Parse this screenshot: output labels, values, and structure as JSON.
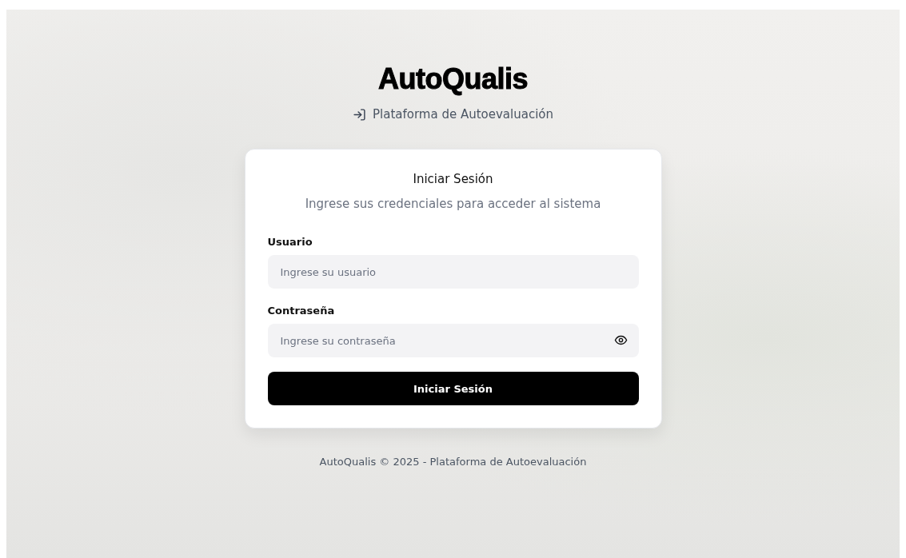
{
  "brand": {
    "title": "AutoQualis",
    "subtitle": "Plataforma de Autoevaluación"
  },
  "card": {
    "title": "Iniciar Sesión",
    "description": "Ingrese sus credenciales para acceder al sistema",
    "fields": [
      {
        "kind": "text",
        "label": "Usuario",
        "placeholder": "Ingrese su usuario"
      },
      {
        "kind": "password",
        "label": "Contraseña",
        "placeholder": "Ingrese su contraseña"
      }
    ],
    "submit": "Iniciar Sesión"
  },
  "footer": "AutoQualis © 2025 - Plataforma de Autoevaluación"
}
